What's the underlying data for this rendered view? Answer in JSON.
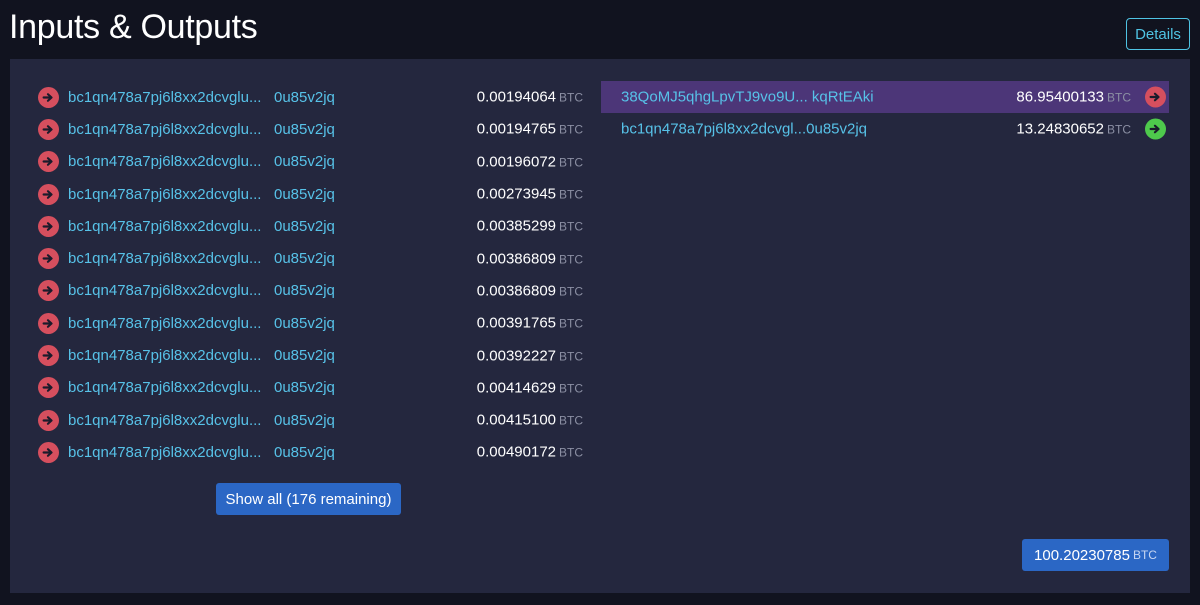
{
  "header": {
    "title": "Inputs & Outputs",
    "details_label": "Details"
  },
  "colors": {
    "input_arrow": "#d64f5e",
    "output_spent_arrow": "#d64f5e",
    "output_unspent_arrow": "#4ec94c",
    "link": "#57c2e8",
    "highlight_row": "#4c3678",
    "button_blue": "#2b67c5"
  },
  "inputs": [
    {
      "addr_start": "bc1qn478a7pj6l8xx2dcvglu...",
      "addr_end": "0u85v2jq",
      "amount": "0.00194064",
      "unit": "BTC",
      "icon": "arrow-right-icon"
    },
    {
      "addr_start": "bc1qn478a7pj6l8xx2dcvglu...",
      "addr_end": "0u85v2jq",
      "amount": "0.00194765",
      "unit": "BTC",
      "icon": "arrow-right-icon"
    },
    {
      "addr_start": "bc1qn478a7pj6l8xx2dcvglu...",
      "addr_end": "0u85v2jq",
      "amount": "0.00196072",
      "unit": "BTC",
      "icon": "arrow-right-icon"
    },
    {
      "addr_start": "bc1qn478a7pj6l8xx2dcvglu...",
      "addr_end": "0u85v2jq",
      "amount": "0.00273945",
      "unit": "BTC",
      "icon": "arrow-right-icon"
    },
    {
      "addr_start": "bc1qn478a7pj6l8xx2dcvglu...",
      "addr_end": "0u85v2jq",
      "amount": "0.00385299",
      "unit": "BTC",
      "icon": "arrow-right-icon"
    },
    {
      "addr_start": "bc1qn478a7pj6l8xx2dcvglu...",
      "addr_end": "0u85v2jq",
      "amount": "0.00386809",
      "unit": "BTC",
      "icon": "arrow-right-icon"
    },
    {
      "addr_start": "bc1qn478a7pj6l8xx2dcvglu...",
      "addr_end": "0u85v2jq",
      "amount": "0.00386809",
      "unit": "BTC",
      "icon": "arrow-right-icon"
    },
    {
      "addr_start": "bc1qn478a7pj6l8xx2dcvglu...",
      "addr_end": "0u85v2jq",
      "amount": "0.00391765",
      "unit": "BTC",
      "icon": "arrow-right-icon"
    },
    {
      "addr_start": "bc1qn478a7pj6l8xx2dcvglu...",
      "addr_end": "0u85v2jq",
      "amount": "0.00392227",
      "unit": "BTC",
      "icon": "arrow-right-icon"
    },
    {
      "addr_start": "bc1qn478a7pj6l8xx2dcvglu...",
      "addr_end": "0u85v2jq",
      "amount": "0.00414629",
      "unit": "BTC",
      "icon": "arrow-right-icon"
    },
    {
      "addr_start": "bc1qn478a7pj6l8xx2dcvglu...",
      "addr_end": "0u85v2jq",
      "amount": "0.00415100",
      "unit": "BTC",
      "icon": "arrow-right-icon"
    },
    {
      "addr_start": "bc1qn478a7pj6l8xx2dcvglu...",
      "addr_end": "0u85v2jq",
      "amount": "0.00490172",
      "unit": "BTC",
      "icon": "arrow-right-icon"
    }
  ],
  "show_all_label": "Show all (176 remaining)",
  "outputs": [
    {
      "address": "38QoMJ5qhgLpvTJ9vo9U... kqRtEAki",
      "amount": "86.95400133",
      "unit": "BTC",
      "status": "spent",
      "icon": "arrow-right-icon",
      "highlighted": true
    },
    {
      "address": "bc1qn478a7pj6l8xx2dcvgl...0u85v2jq",
      "amount": "13.24830652",
      "unit": "BTC",
      "status": "unspent",
      "icon": "arrow-right-icon",
      "highlighted": false
    }
  ],
  "total": {
    "amount": "100.20230785",
    "unit": "BTC"
  }
}
